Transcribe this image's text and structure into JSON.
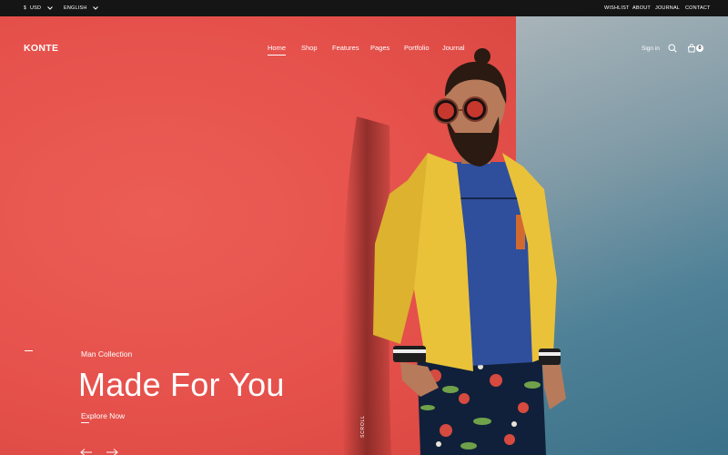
{
  "topbar": {
    "currency": "USD",
    "currency_symbol": "$",
    "language": "ENGLISH",
    "links": [
      "WISHLIST",
      "ABOUT",
      "JOURNAL",
      "CONTACT"
    ]
  },
  "header": {
    "logo": "KONTE",
    "nav": [
      "Home",
      "Shop",
      "Features",
      "Pages",
      "Portfolio",
      "Journal"
    ],
    "active_nav": "Home",
    "signin": "Sign in",
    "cart_count": "0"
  },
  "hero": {
    "subtitle": "Man Collection",
    "headline": "Made For You",
    "cta": "Explore Now",
    "scroll_label": "Scroll"
  },
  "colors": {
    "topbar_bg": "#151515",
    "hero_red": "#e6514c",
    "hero_blue": "#4f8197",
    "jacket_yellow": "#e9c23a",
    "sweater_blue": "#2f4f9c"
  },
  "icons": [
    "chevron-down-icon",
    "search-icon",
    "cart-icon",
    "arrow-left-icon",
    "arrow-right-icon"
  ]
}
